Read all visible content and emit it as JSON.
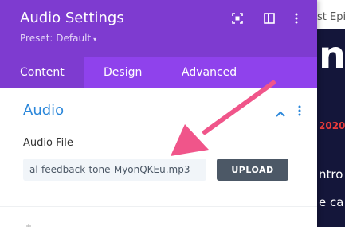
{
  "background_page": {
    "top_text": "st Epi",
    "big_text": "na",
    "year_text": "2020",
    "line1": "ntro",
    "line2": "e ca"
  },
  "panel": {
    "title": "Audio Settings",
    "preset_label": "Preset: Default",
    "preset_caret": "▾",
    "header_icons": [
      "focus-icon",
      "columns-icon",
      "more-icon"
    ],
    "tabs": [
      {
        "label": "Content",
        "active": true
      },
      {
        "label": "Design",
        "active": false
      },
      {
        "label": "Advanced",
        "active": false
      }
    ],
    "section": {
      "title": "Audio",
      "field_label": "Audio File",
      "file_value": "al-feedback-tone-MyonQKEu.mp3",
      "upload_label": "UPLOAD"
    }
  },
  "colors": {
    "header": "#7e3bd0",
    "tabs_bar": "#8f42ec",
    "active_tab": "#7e3bd0",
    "section_title": "#2b87da",
    "upload_button": "#4c5866",
    "input_bg": "#f1f5f9",
    "annotation_arrow": "#f0558a",
    "bg_dark": "#14163a",
    "bg_red_text": "#e83b3b"
  }
}
